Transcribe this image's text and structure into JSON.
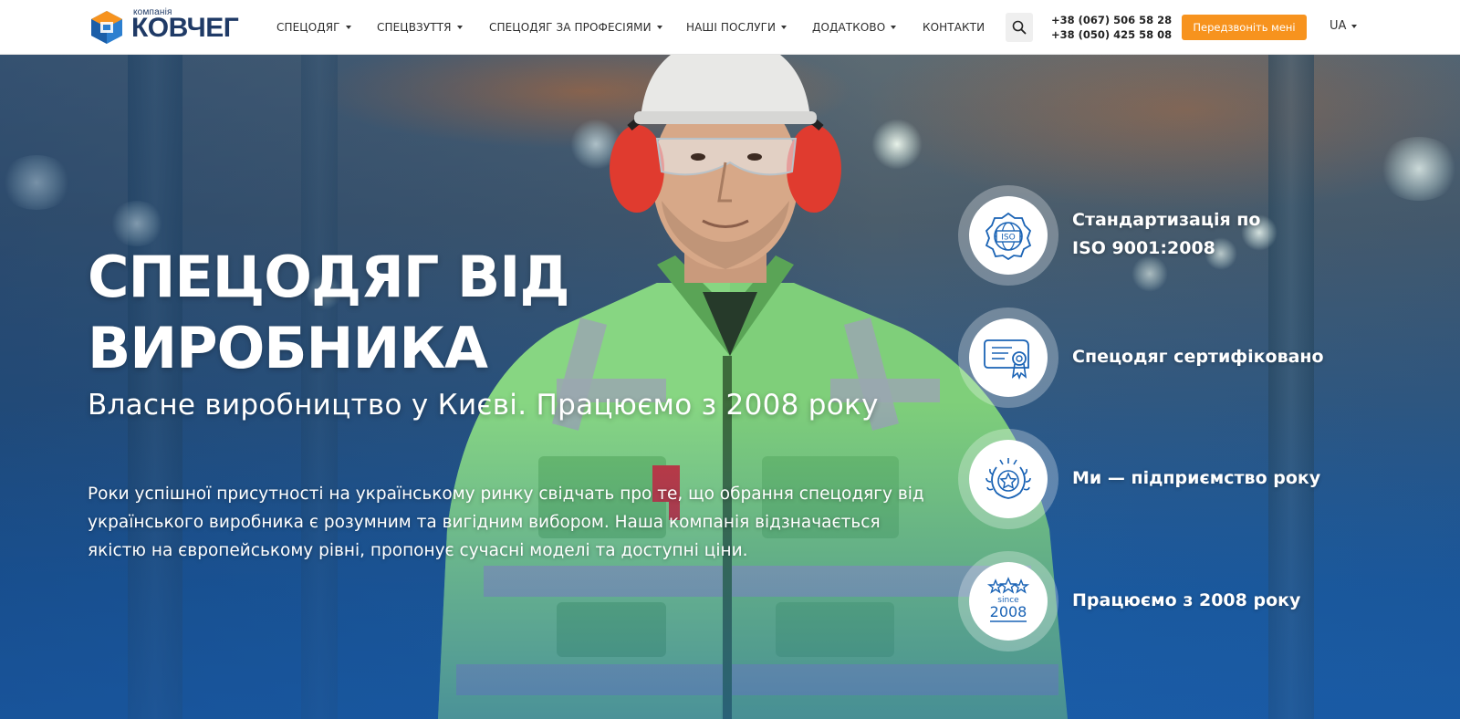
{
  "header": {
    "logo": {
      "small_text": "компанія",
      "brand": "КОВЧЕГ"
    },
    "nav": [
      {
        "label": "СПЕЦОДЯГ",
        "has_dropdown": true
      },
      {
        "label": "СПЕЦВЗУТТЯ",
        "has_dropdown": true
      },
      {
        "label": "СПЕЦОДЯГ ЗА ПРОФЕСІЯМИ",
        "has_dropdown": true
      },
      {
        "label": "НАШІ ПОСЛУГИ",
        "has_dropdown": true
      },
      {
        "label": "ДОДАТКОВО",
        "has_dropdown": true
      },
      {
        "label": "КОНТАКТИ",
        "has_dropdown": false
      }
    ],
    "search_icon": "search-icon",
    "phones": [
      "+38 (067) 506 58 28",
      "+38 (050) 425 58 08"
    ],
    "callback_label": "Передзвоніть мені",
    "language": "UA"
  },
  "hero": {
    "title_line1": "СПЕЦОДЯГ ВІД",
    "title_line2": "ВИРОБНИКА",
    "subtitle": "Власне виробництво у Києві. Працюємо з 2008 року",
    "text": "Роки успішної присутності на українському ринку свідчать про те, що обрання спецодягу від українського виробника є розумним та вигідним вибором. Наша компанія відзначається якістю на європейському рівні, пропонує сучасні моделі та доступні ціни."
  },
  "features": [
    {
      "icon": "iso-icon",
      "label_line1": "Стандартизація по",
      "label_line2": "ISO 9001:2008"
    },
    {
      "icon": "certificate-icon",
      "label_line1": "Спецодяг сертифіковано",
      "label_line2": ""
    },
    {
      "icon": "award-star-icon",
      "label_line1": "Ми — підприємство року",
      "label_line2": ""
    },
    {
      "icon": "since-2008-icon",
      "label_line1": "Працюємо з 2008 року",
      "label_line2": "",
      "badge_small": "since",
      "badge_year": "2008"
    }
  ],
  "colors": {
    "brand_blue": "#1f3a66",
    "accent_orange": "#f7931e",
    "icon_blue": "#1a63b5"
  }
}
